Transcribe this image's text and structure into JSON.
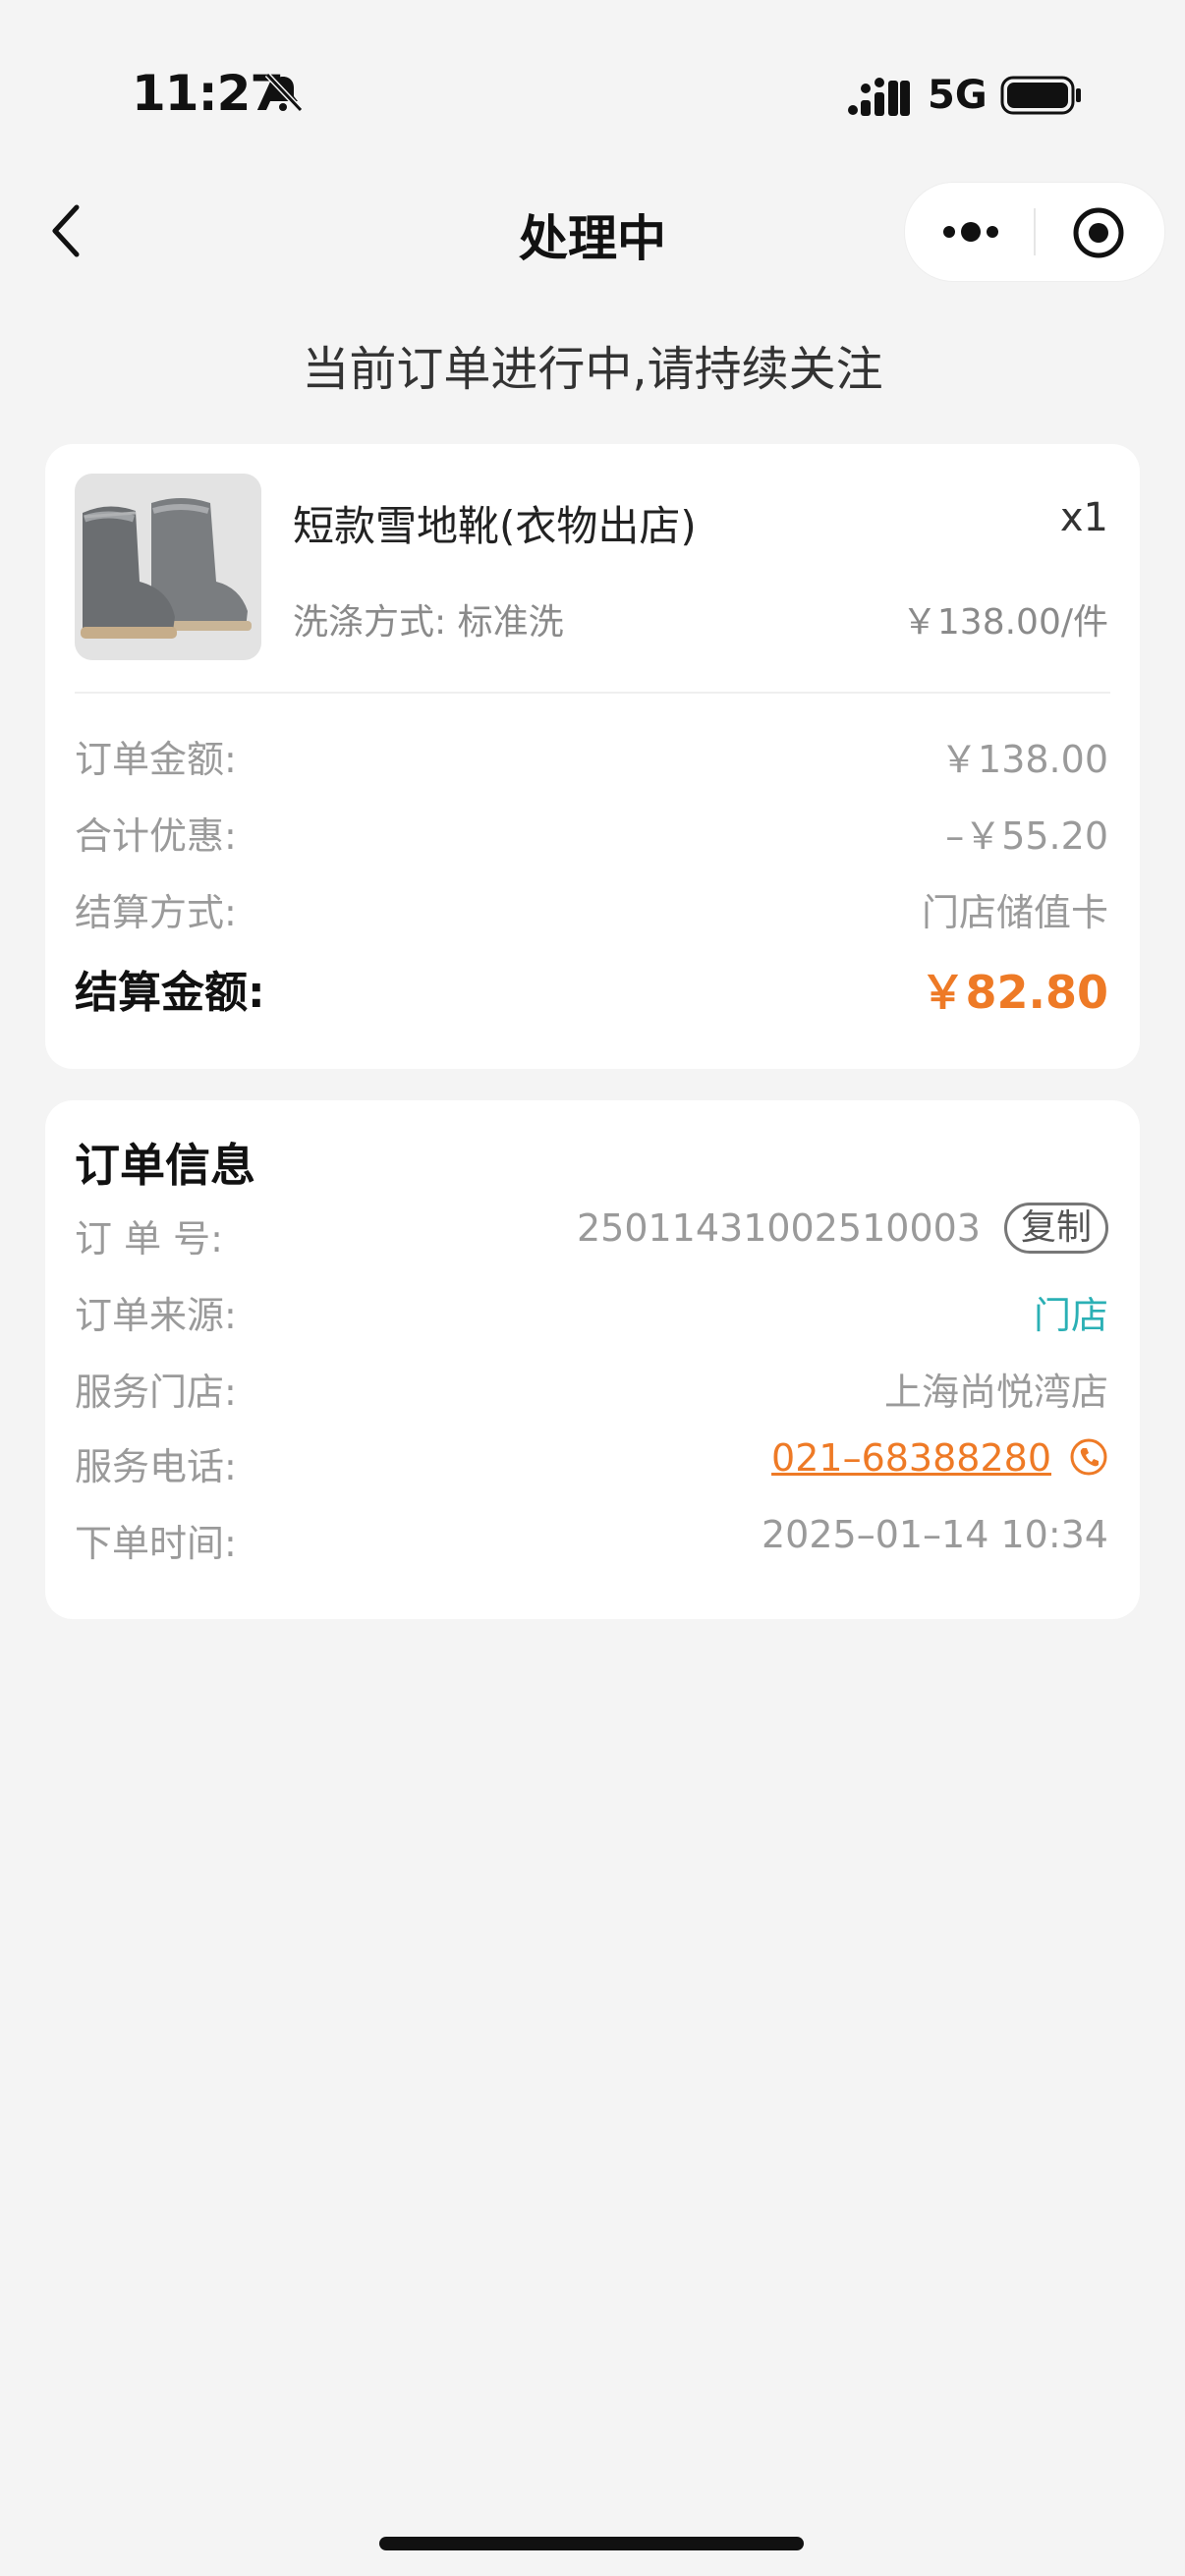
{
  "status_bar": {
    "time": "11:27",
    "network": "5G"
  },
  "nav": {
    "title": "处理中"
  },
  "subtitle": "当前订单进行中,请持续关注",
  "product": {
    "name": "短款雪地靴(衣物出店)",
    "quantity": "x1",
    "wash_method": "洗涤方式: 标准洗",
    "unit_price": "￥138.00/件"
  },
  "payment": {
    "rows": [
      {
        "label": "订单金额:",
        "value": "￥138.00"
      },
      {
        "label": "合计优惠:",
        "value": "–￥55.20"
      },
      {
        "label": "结算方式:",
        "value": "门店储值卡"
      }
    ],
    "total_label": "结算金额:",
    "total_value": "￥82.80"
  },
  "order_info": {
    "title": "订单信息",
    "order_no_label": "订 单 号:",
    "order_no": "25011431002510003",
    "copy_label": "复制",
    "source_label": "订单来源:",
    "source": "门店",
    "store_label": "服务门店:",
    "store": "上海尚悦湾店",
    "phone_label": "服务电话:",
    "phone": "021–68388280",
    "time_label": "下单时间:",
    "time": "2025–01–14 10:34"
  },
  "colors": {
    "accent_orange": "#ee7a26",
    "accent_teal": "#2bb0b5",
    "background": "#f4f4f4"
  },
  "icons": [
    "bell-slash-icon",
    "signal-icon",
    "battery-icon",
    "back-chevron-icon",
    "more-dots-icon",
    "target-icon",
    "phone-icon"
  ]
}
